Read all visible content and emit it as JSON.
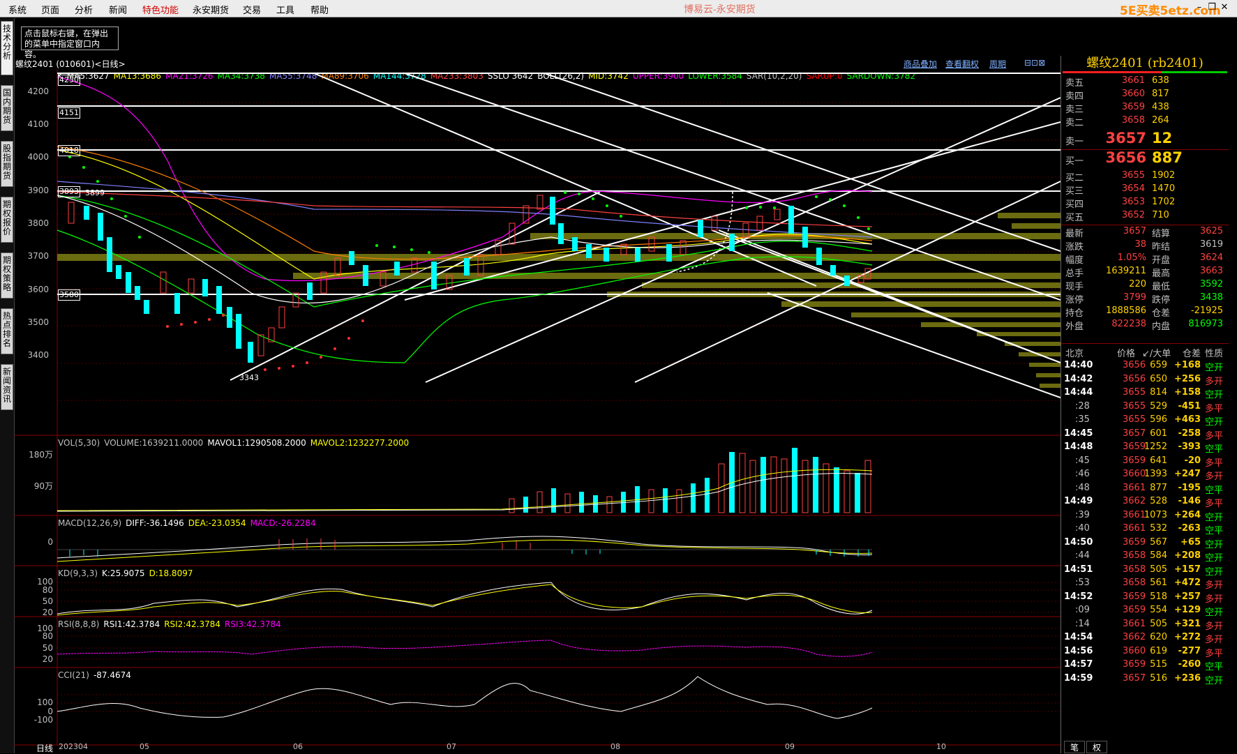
{
  "app": {
    "title": "博易云-永安期货",
    "watermark": "5E买卖5etz.com",
    "menu": [
      "系统",
      "页面",
      "分析",
      "新闻",
      "特色功能",
      "永安期货",
      "交易",
      "工具",
      "帮助"
    ],
    "active_menu_color": "#d00000"
  },
  "left_tabs": [
    "技术分析",
    "国内期货",
    "股指期货",
    "期权报价",
    "期权策略",
    "热点排名",
    "新闻资讯"
  ],
  "hint": "点击鼠标右键，在弹出的菜单中指定窗口内容。",
  "chart": {
    "header_title": "螺纹2401 (010601)<日线>",
    "links": [
      "商品叠加",
      "查看翻权",
      "周期"
    ],
    "ma_line": [
      {
        "text": "K",
        "color": "#ffffff"
      },
      {
        "text": "MA5:3627",
        "color": "#ffffff"
      },
      {
        "text": "MA13:3686",
        "color": "#ffff00"
      },
      {
        "text": "MA21:3726",
        "color": "#ff00ff"
      },
      {
        "text": "MA34:3738",
        "color": "#00ff00"
      },
      {
        "text": "MA55:3748",
        "color": "#8080ff"
      },
      {
        "text": "MA89:3706",
        "color": "#ff8000"
      },
      {
        "text": "MA144:3728",
        "color": "#00ffff"
      },
      {
        "text": "MA233:3803",
        "color": "#ff4040"
      },
      {
        "text": "SSLO 3642",
        "color": "#ffffff"
      },
      {
        "text": "BOLL(26,2)",
        "color": "#ffffff"
      },
      {
        "text": "MID:3742",
        "color": "#ffff00"
      },
      {
        "text": "UPPER:3900",
        "color": "#ff00ff"
      },
      {
        "text": "LOWER:3584",
        "color": "#00ff00"
      },
      {
        "text": "SAR(10,2,20)",
        "color": "#c0c0c0"
      },
      {
        "text": "SARUP:0",
        "color": "#ff0000"
      },
      {
        "text": "SARDOWN:3782",
        "color": "#00ff00"
      }
    ],
    "price_ticks": [
      "4200",
      "4100",
      "4000",
      "3900",
      "3800",
      "3700",
      "3600",
      "3500",
      "3400"
    ],
    "level_boxes": [
      "4250",
      "4151",
      "4018",
      "3893",
      "3580"
    ],
    "extra_labels": {
      "near_3893": "3899",
      "low": "3343"
    },
    "date_ticks": [
      "日线",
      "202304",
      "05",
      "06",
      "07",
      "08",
      "09",
      "10"
    ]
  },
  "indicators": {
    "vol": {
      "label": [
        {
          "text": "VOL(5,30)",
          "color": "#c0c0c0"
        },
        {
          "text": "VOLUME:1639211.0000",
          "color": "#c0c0c0"
        },
        {
          "text": "MAVOL1:1290508.2000",
          "color": "#ffffff"
        },
        {
          "text": "MAVOL2:1232277.2000",
          "color": "#ffff00"
        }
      ],
      "ticks": [
        "180万",
        "90万"
      ]
    },
    "macd": {
      "label": [
        {
          "text": "MACD(12,26,9)",
          "color": "#c0c0c0"
        },
        {
          "text": "DIFF:-36.1496",
          "color": "#ffffff"
        },
        {
          "text": "DEA:-23.0354",
          "color": "#ffff00"
        },
        {
          "text": "MACD:-26.2284",
          "color": "#ff00ff"
        }
      ],
      "ticks": [
        "0"
      ]
    },
    "kd": {
      "label": [
        {
          "text": "KD(9,3,3)",
          "color": "#c0c0c0"
        },
        {
          "text": "K:25.9075",
          "color": "#ffffff"
        },
        {
          "text": "D:18.8097",
          "color": "#ffff00"
        }
      ],
      "ticks": [
        "100",
        "80",
        "50",
        "20"
      ]
    },
    "rsi": {
      "label": [
        {
          "text": "RSI(8,8,8)",
          "color": "#c0c0c0"
        },
        {
          "text": "RSI1:42.3784",
          "color": "#ffffff"
        },
        {
          "text": "RSI2:42.3784",
          "color": "#ffff00"
        },
        {
          "text": "RSI3:42.3784",
          "color": "#ff00ff"
        }
      ],
      "ticks": [
        "100",
        "80",
        "50",
        "20"
      ]
    },
    "cci": {
      "label": [
        {
          "text": "CCI(21)",
          "color": "#c0c0c0"
        },
        {
          "text": "-87.4674",
          "color": "#ffffff"
        }
      ],
      "ticks": [
        "100",
        "0",
        "-100"
      ]
    }
  },
  "quote": {
    "title": "螺纹2401 (rb2401)",
    "asks": [
      {
        "label": "卖五",
        "price": "3661",
        "vol": "638"
      },
      {
        "label": "卖四",
        "price": "3660",
        "vol": "817"
      },
      {
        "label": "卖三",
        "price": "3659",
        "vol": "438"
      },
      {
        "label": "卖二",
        "price": "3658",
        "vol": "264"
      }
    ],
    "ask1": {
      "label": "卖一",
      "price": "3657",
      "vol": "12"
    },
    "bid1": {
      "label": "买一",
      "price": "3656",
      "vol": "887"
    },
    "bids": [
      {
        "label": "买二",
        "price": "3655",
        "vol": "1902"
      },
      {
        "label": "买三",
        "price": "3654",
        "vol": "1470"
      },
      {
        "label": "买四",
        "price": "3653",
        "vol": "1702"
      },
      {
        "label": "买五",
        "price": "3652",
        "vol": "710"
      }
    ],
    "stats": [
      {
        "l1": "最新",
        "v1": "3657",
        "c1": "#ff4040",
        "l2": "结算",
        "v2": "3625",
        "c2": "#ff4040"
      },
      {
        "l1": "涨跌",
        "v1": "38",
        "c1": "#ff4040",
        "l2": "昨结",
        "v2": "3619",
        "c2": "#c0c0c0"
      },
      {
        "l1": "幅度",
        "v1": "1.05%",
        "c1": "#ff4040",
        "l2": "开盘",
        "v2": "3624",
        "c2": "#ff4040"
      },
      {
        "l1": "总手",
        "v1": "1639211",
        "c1": "#ffd200",
        "l2": "最高",
        "v2": "3663",
        "c2": "#ff4040"
      },
      {
        "l1": "现手",
        "v1": "220",
        "c1": "#ffd200",
        "l2": "最低",
        "v2": "3592",
        "c2": "#00ff00"
      },
      {
        "l1": "涨停",
        "v1": "3799",
        "c1": "#ff4040",
        "l2": "跌停",
        "v2": "3438",
        "c2": "#00ff00"
      },
      {
        "l1": "持仓",
        "v1": "1888586",
        "c1": "#ffd200",
        "l2": "仓差",
        "v2": "-21925",
        "c2": "#ffd200"
      },
      {
        "l1": "外盘",
        "v1": "822238",
        "c1": "#ff4040",
        "l2": "内盘",
        "v2": "816973",
        "c2": "#00ff00"
      }
    ],
    "tick_header": [
      "北京",
      "价格",
      "↙/大单",
      "仓差",
      "性质"
    ],
    "ticks": [
      {
        "t": "14:40",
        "p": "3656",
        "v": "659",
        "d": "+168",
        "n": "空开",
        "nc": "#00ff00"
      },
      {
        "t": "14:42",
        "p": "3656",
        "v": "650",
        "d": "+256",
        "n": "多开",
        "nc": "#ff4040"
      },
      {
        "t": "14:44",
        "p": "3655",
        "v": "814",
        "d": "+158",
        "n": "空开",
        "nc": "#00ff00"
      },
      {
        "t": ":28",
        "p": "3655",
        "v": "529",
        "d": "-451",
        "n": "多平",
        "nc": "#ff4040"
      },
      {
        "t": ":35",
        "p": "3655",
        "v": "596",
        "d": "+463",
        "n": "空开",
        "nc": "#00ff00"
      },
      {
        "t": "14:45",
        "p": "3657",
        "v": "601",
        "d": "-258",
        "n": "多平",
        "nc": "#ff4040"
      },
      {
        "t": "14:48",
        "p": "3659",
        "v": "1252",
        "d": "-393",
        "n": "空平",
        "nc": "#00ff00"
      },
      {
        "t": ":45",
        "p": "3659",
        "v": "641",
        "d": "-20",
        "n": "多平",
        "nc": "#ff4040"
      },
      {
        "t": ":46",
        "p": "3660",
        "v": "1393",
        "d": "+247",
        "n": "多开",
        "nc": "#ff4040"
      },
      {
        "t": ":48",
        "p": "3661",
        "v": "877",
        "d": "-195",
        "n": "空平",
        "nc": "#00ff00"
      },
      {
        "t": "14:49",
        "p": "3662",
        "v": "528",
        "d": "-146",
        "n": "多平",
        "nc": "#ff4040"
      },
      {
        "t": ":39",
        "p": "3661",
        "v": "1073",
        "d": "+264",
        "n": "空开",
        "nc": "#00ff00"
      },
      {
        "t": ":40",
        "p": "3661",
        "v": "532",
        "d": "-263",
        "n": "空平",
        "nc": "#00ff00"
      },
      {
        "t": "14:50",
        "p": "3659",
        "v": "567",
        "d": "+65",
        "n": "空开",
        "nc": "#00ff00"
      },
      {
        "t": ":44",
        "p": "3658",
        "v": "584",
        "d": "+208",
        "n": "空开",
        "nc": "#00ff00"
      },
      {
        "t": "14:51",
        "p": "3658",
        "v": "505",
        "d": "+157",
        "n": "空开",
        "nc": "#00ff00"
      },
      {
        "t": ":53",
        "p": "3658",
        "v": "561",
        "d": "+472",
        "n": "多开",
        "nc": "#ff4040"
      },
      {
        "t": "14:52",
        "p": "3659",
        "v": "518",
        "d": "+257",
        "n": "多开",
        "nc": "#ff4040"
      },
      {
        "t": ":09",
        "p": "3659",
        "v": "554",
        "d": "+129",
        "n": "空开",
        "nc": "#00ff00"
      },
      {
        "t": ":14",
        "p": "3661",
        "v": "505",
        "d": "+321",
        "n": "多开",
        "nc": "#ff4040"
      },
      {
        "t": "14:54",
        "p": "3662",
        "v": "620",
        "d": "+272",
        "n": "多开",
        "nc": "#ff4040"
      },
      {
        "t": "14:56",
        "p": "3660",
        "v": "619",
        "d": "-277",
        "n": "多平",
        "nc": "#ff4040"
      },
      {
        "t": "14:57",
        "p": "3659",
        "v": "515",
        "d": "-260",
        "n": "空平",
        "nc": "#00ff00"
      },
      {
        "t": "14:59",
        "p": "3657",
        "v": "516",
        "d": "+236",
        "n": "空开",
        "nc": "#00ff00"
      }
    ],
    "bottom_tabs": [
      "笔",
      "权"
    ]
  }
}
